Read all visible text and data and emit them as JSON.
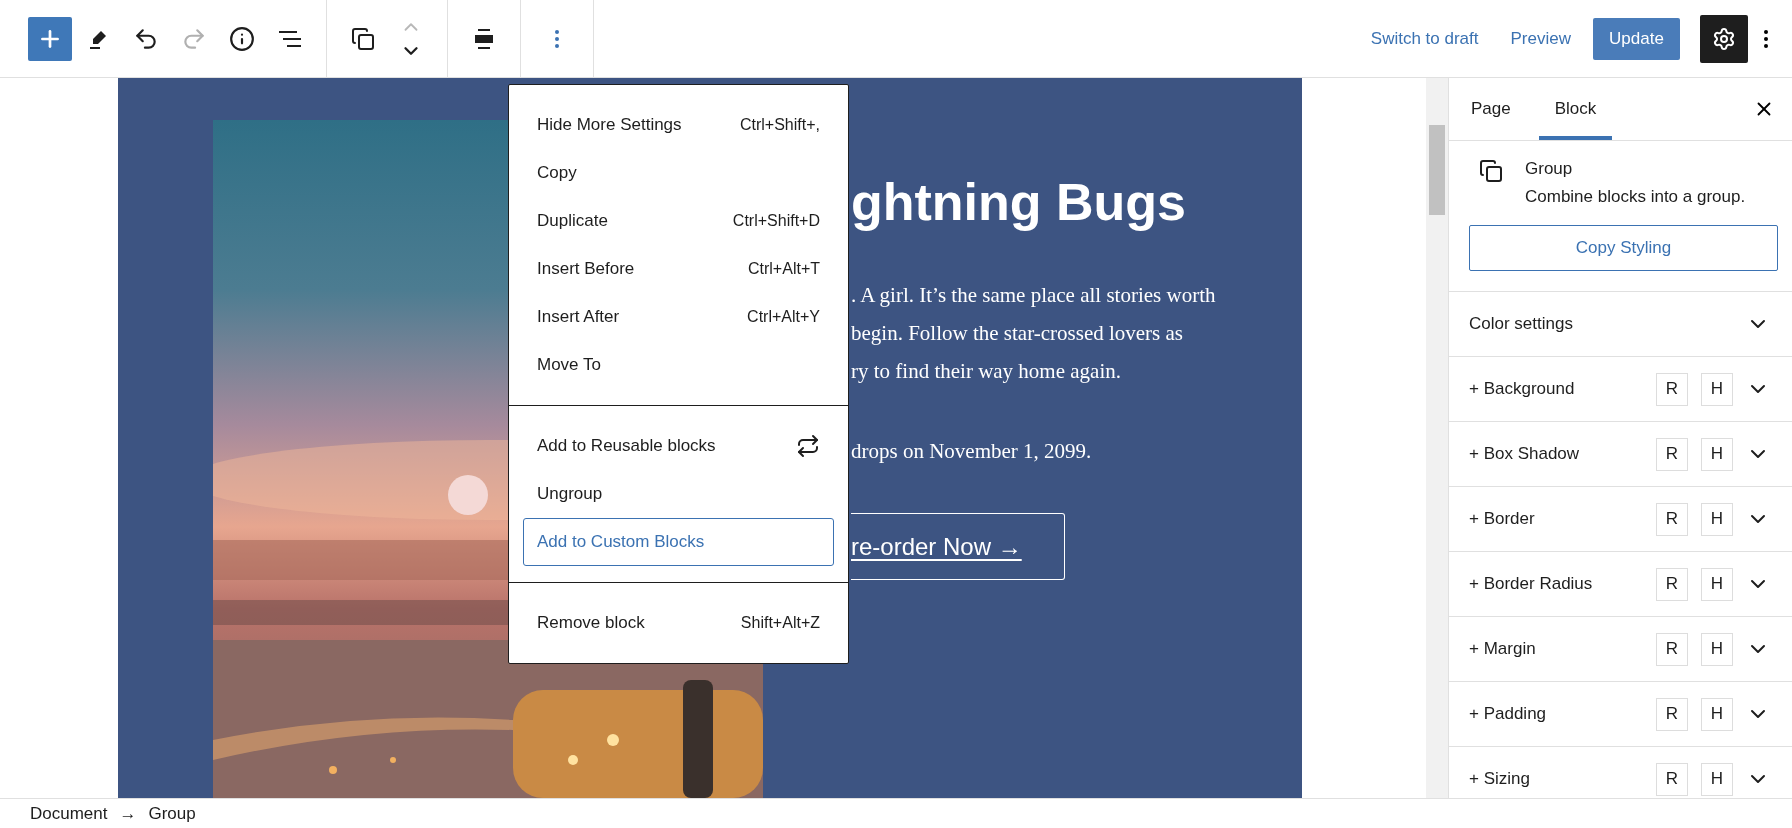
{
  "toolbar": {
    "tool_groups": [
      [
        {
          "kind": "add",
          "disabled": false
        },
        {
          "kind": "edit",
          "disabled": false
        },
        {
          "kind": "undo",
          "disabled": false
        },
        {
          "kind": "redo",
          "disabled": true
        },
        {
          "kind": "info",
          "disabled": false
        },
        {
          "kind": "list",
          "disabled": false
        }
      ],
      [
        {
          "kind": "group",
          "disabled": false
        },
        {
          "kind": "mover",
          "disabled": false,
          "up_disabled": true
        }
      ],
      [
        {
          "kind": "align",
          "disabled": false
        }
      ],
      [
        {
          "kind": "more",
          "disabled": false
        }
      ]
    ],
    "switch_to_draft": "Switch to draft",
    "preview": "Preview",
    "update": "Update",
    "settings_active": true
  },
  "canvas": {
    "heading": "ghtning Bugs",
    "lines": [
      ". A girl. It’s the same place all stories worth",
      "begin. Follow the star-crossed lovers as",
      "ry to find their way home again."
    ],
    "release_line": "drops on November 1, 2099.",
    "button": "re-order Now →"
  },
  "menu": {
    "groups": [
      [
        {
          "label": "Hide More Settings",
          "kind": "shortcut",
          "shortcut": "Ctrl+Shift+,",
          "selected": false
        },
        {
          "label": "Copy",
          "kind": "plain",
          "selected": false
        },
        {
          "label": "Duplicate",
          "kind": "shortcut",
          "shortcut": "Ctrl+Shift+D",
          "selected": false
        },
        {
          "label": "Insert Before",
          "kind": "shortcut",
          "shortcut": "Ctrl+Alt+T",
          "selected": false
        },
        {
          "label": "Insert After",
          "kind": "shortcut",
          "shortcut": "Ctrl+Alt+Y",
          "selected": false
        },
        {
          "label": "Move To",
          "kind": "plain",
          "selected": false
        }
      ],
      [
        {
          "label": "Add to Reusable blocks",
          "kind": "icon",
          "selected": false
        },
        {
          "label": "Ungroup",
          "kind": "plain",
          "selected": false
        },
        {
          "label": "Add to Custom Blocks",
          "kind": "plain",
          "selected": true
        }
      ],
      [
        {
          "label": "Remove block",
          "kind": "shortcut",
          "shortcut": "Shift+Alt+Z",
          "selected": false
        }
      ]
    ]
  },
  "sidebar": {
    "tabs": [
      {
        "label": "Page",
        "selected": false
      },
      {
        "label": "Block",
        "selected": true
      }
    ],
    "block": {
      "title": "Group",
      "description": "Combine blocks into a group."
    },
    "copy_styling": "Copy Styling",
    "panels": [
      {
        "label": "Color settings",
        "kind": "section"
      },
      {
        "label": "+ Background",
        "kind": "style",
        "buttons": [
          "R",
          "H"
        ]
      },
      {
        "label": "+ Box Shadow",
        "kind": "style",
        "buttons": [
          "R",
          "H"
        ]
      },
      {
        "label": "+ Border",
        "kind": "style",
        "buttons": [
          "R",
          "H"
        ]
      },
      {
        "label": "+ Border Radius",
        "kind": "style",
        "buttons": [
          "R",
          "H"
        ]
      },
      {
        "label": "+ Margin",
        "kind": "style",
        "buttons": [
          "R",
          "H"
        ]
      },
      {
        "label": "+ Padding",
        "kind": "style",
        "buttons": [
          "R",
          "H"
        ]
      },
      {
        "label": "+ Sizing",
        "kind": "style",
        "buttons": [
          "R",
          "H"
        ]
      }
    ]
  },
  "breadcrumb": {
    "items": [
      "Document",
      "Group"
    ],
    "separator": "→"
  }
}
